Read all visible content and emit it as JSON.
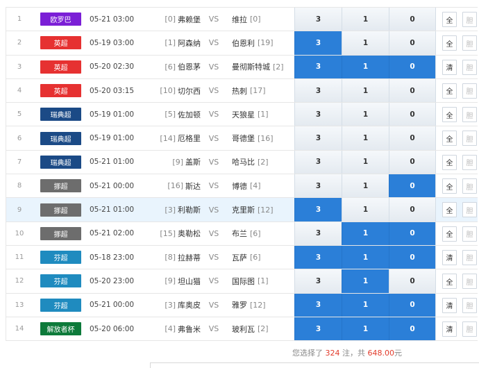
{
  "matches": [
    {
      "idx": "1",
      "league": "欧罗巴",
      "league_color": "#7b1fd6",
      "time": "05-21 03:00",
      "home_rank": "[0]",
      "home": "弗赖堡",
      "vs": "VS",
      "away": "维拉",
      "away_rank": "[0]",
      "opt3": "3",
      "opt1": "1",
      "opt0": "0",
      "sel": [
        false,
        false,
        false
      ],
      "btn1": "全",
      "btn2": "胆",
      "highlight": false
    },
    {
      "idx": "2",
      "league": "英超",
      "league_color": "#e63131",
      "time": "05-19 03:00",
      "home_rank": "[1]",
      "home": "阿森纳",
      "vs": "VS",
      "away": "伯恩利",
      "away_rank": "[19]",
      "opt3": "3",
      "opt1": "1",
      "opt0": "0",
      "sel": [
        true,
        false,
        false
      ],
      "btn1": "全",
      "btn2": "胆",
      "highlight": false
    },
    {
      "idx": "3",
      "league": "英超",
      "league_color": "#e63131",
      "time": "05-20 02:30",
      "home_rank": "[6]",
      "home": "伯恩茅",
      "vs": "VS",
      "away": "曼彻斯特城",
      "away_rank": "[2]",
      "opt3": "3",
      "opt1": "1",
      "opt0": "0",
      "sel": [
        true,
        true,
        true
      ],
      "btn1": "清",
      "btn2": "胆",
      "highlight": false
    },
    {
      "idx": "4",
      "league": "英超",
      "league_color": "#e63131",
      "time": "05-20 03:15",
      "home_rank": "[10]",
      "home": "切尔西",
      "vs": "VS",
      "away": "热刺",
      "away_rank": "[17]",
      "opt3": "3",
      "opt1": "1",
      "opt0": "0",
      "sel": [
        false,
        false,
        false
      ],
      "btn1": "全",
      "btn2": "胆",
      "highlight": false
    },
    {
      "idx": "5",
      "league": "瑞典超",
      "league_color": "#1b4a86",
      "time": "05-19 01:00",
      "home_rank": "[5]",
      "home": "佐加顿",
      "vs": "VS",
      "away": "天狼星",
      "away_rank": "[1]",
      "opt3": "3",
      "opt1": "1",
      "opt0": "0",
      "sel": [
        false,
        false,
        false
      ],
      "btn1": "全",
      "btn2": "胆",
      "highlight": false
    },
    {
      "idx": "6",
      "league": "瑞典超",
      "league_color": "#1b4a86",
      "time": "05-19 01:00",
      "home_rank": "[14]",
      "home": "厄格里",
      "vs": "VS",
      "away": "哥德堡",
      "away_rank": "[16]",
      "opt3": "3",
      "opt1": "1",
      "opt0": "0",
      "sel": [
        false,
        false,
        false
      ],
      "btn1": "全",
      "btn2": "胆",
      "highlight": false
    },
    {
      "idx": "7",
      "league": "瑞典超",
      "league_color": "#1b4a86",
      "time": "05-21 01:00",
      "home_rank": "[9]",
      "home": "盖斯",
      "vs": "VS",
      "away": "哈马比",
      "away_rank": "[2]",
      "opt3": "3",
      "opt1": "1",
      "opt0": "0",
      "sel": [
        false,
        false,
        false
      ],
      "btn1": "全",
      "btn2": "胆",
      "highlight": false
    },
    {
      "idx": "8",
      "league": "挪超",
      "league_color": "#6d6d6d",
      "time": "05-21 00:00",
      "home_rank": "[16]",
      "home": "斯达",
      "vs": "VS",
      "away": "博德",
      "away_rank": "[4]",
      "opt3": "3",
      "opt1": "1",
      "opt0": "0",
      "sel": [
        false,
        false,
        true
      ],
      "btn1": "全",
      "btn2": "胆",
      "highlight": false
    },
    {
      "idx": "9",
      "league": "挪超",
      "league_color": "#6d6d6d",
      "time": "05-21 01:00",
      "home_rank": "[3]",
      "home": "利勒斯",
      "vs": "VS",
      "away": "克里斯",
      "away_rank": "[12]",
      "opt3": "3",
      "opt1": "1",
      "opt0": "0",
      "sel": [
        true,
        false,
        false
      ],
      "btn1": "全",
      "btn2": "胆",
      "highlight": true
    },
    {
      "idx": "10",
      "league": "挪超",
      "league_color": "#6d6d6d",
      "time": "05-21 02:00",
      "home_rank": "[15]",
      "home": "奥勒松",
      "vs": "VS",
      "away": "布兰",
      "away_rank": "[6]",
      "opt3": "3",
      "opt1": "1",
      "opt0": "0",
      "sel": [
        false,
        true,
        true
      ],
      "btn1": "全",
      "btn2": "胆",
      "highlight": false
    },
    {
      "idx": "11",
      "league": "芬超",
      "league_color": "#1f8bbf",
      "time": "05-18 23:00",
      "home_rank": "[8]",
      "home": "拉赫蒂",
      "vs": "VS",
      "away": "瓦萨",
      "away_rank": "[6]",
      "opt3": "3",
      "opt1": "1",
      "opt0": "0",
      "sel": [
        true,
        true,
        true
      ],
      "btn1": "清",
      "btn2": "胆",
      "highlight": false
    },
    {
      "idx": "12",
      "league": "芬超",
      "league_color": "#1f8bbf",
      "time": "05-20 23:00",
      "home_rank": "[9]",
      "home": "坦山猫",
      "vs": "VS",
      "away": "国际图",
      "away_rank": "[1]",
      "opt3": "3",
      "opt1": "1",
      "opt0": "0",
      "sel": [
        false,
        true,
        false
      ],
      "btn1": "全",
      "btn2": "胆",
      "highlight": false
    },
    {
      "idx": "13",
      "league": "芬超",
      "league_color": "#1f8bbf",
      "time": "05-21 00:00",
      "home_rank": "[3]",
      "home": "库奥皮",
      "vs": "VS",
      "away": "雅罗",
      "away_rank": "[12]",
      "opt3": "3",
      "opt1": "1",
      "opt0": "0",
      "sel": [
        true,
        true,
        true
      ],
      "btn1": "清",
      "btn2": "胆",
      "highlight": false
    },
    {
      "idx": "14",
      "league": "解放者杯",
      "league_color": "#0d7a3a",
      "time": "05-20 06:00",
      "home_rank": "[4]",
      "home": "弗鲁米",
      "vs": "VS",
      "away": "玻利瓦",
      "away_rank": "[2]",
      "opt3": "3",
      "opt1": "1",
      "opt0": "0",
      "sel": [
        true,
        true,
        true
      ],
      "btn1": "清",
      "btn2": "胆",
      "highlight": false
    }
  ],
  "summary": {
    "prefix": "您选择了 ",
    "count": "324",
    "mid": " 注，共 ",
    "amount": "648.00",
    "suffix": "元"
  },
  "colors": {
    "selected": "#2b7fd8",
    "amount_red": "#e23b2b"
  }
}
